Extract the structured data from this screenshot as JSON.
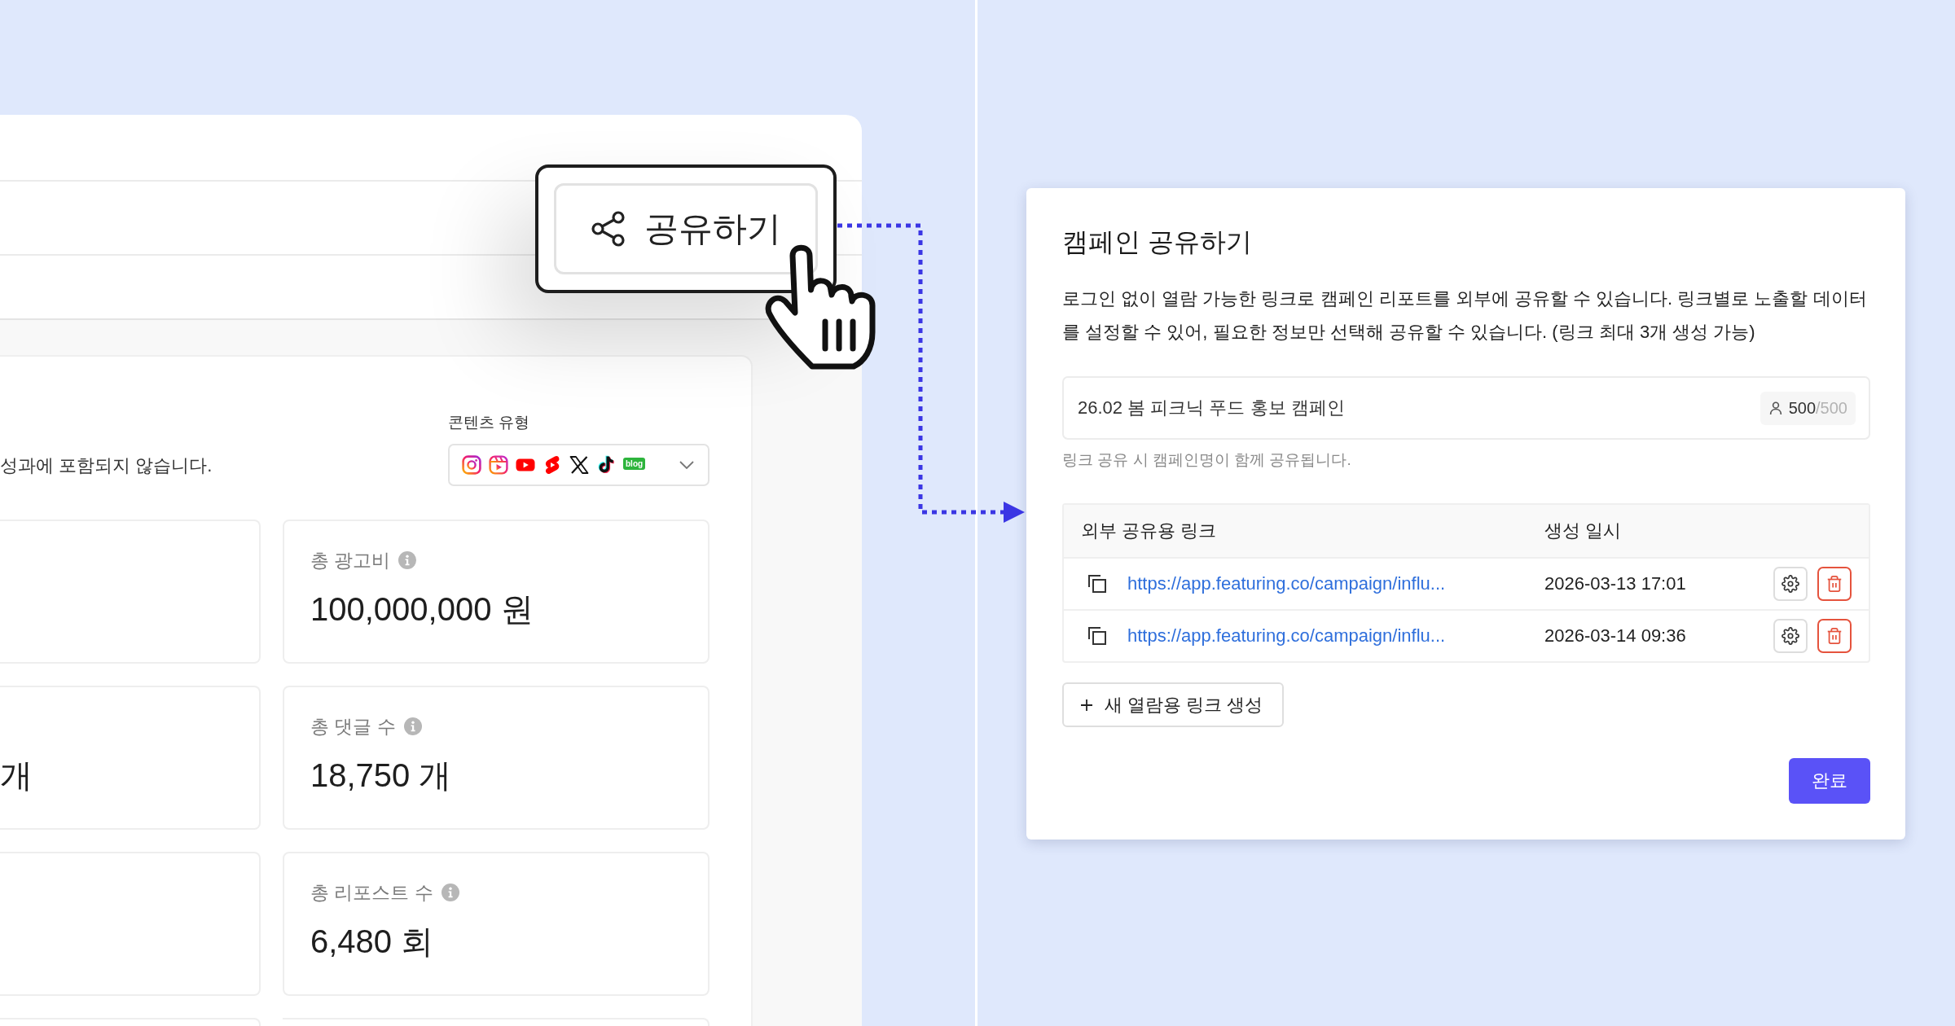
{
  "share_popup": {
    "button_label": "공유하기"
  },
  "report_panel": {
    "notice": "성과에 포함되지 않습니다.",
    "content_type": {
      "label": "콘텐츠 유형",
      "platforms": [
        {
          "kind": "instagram"
        },
        {
          "kind": "reels"
        },
        {
          "kind": "youtube"
        },
        {
          "kind": "shorts"
        },
        {
          "kind": "x"
        },
        {
          "kind": "tiktok"
        },
        {
          "kind": "blog",
          "text": "blog"
        }
      ]
    },
    "card_rows": [
      {
        "cards": [
          {
            "kind": "clipped"
          },
          {
            "kind": "metric",
            "label": "총 광고비",
            "value": "100,000,000 원"
          }
        ]
      },
      {
        "cards": [
          {
            "kind": "clipped",
            "value": "개"
          },
          {
            "kind": "metric",
            "label": "총 댓글 수",
            "value": "18,750 개"
          }
        ]
      },
      {
        "cards": [
          {
            "kind": "clipped"
          },
          {
            "kind": "metric",
            "label": "총 리포스트 수",
            "value": "6,480 회"
          }
        ]
      },
      {
        "cards": [
          {
            "kind": "clipped"
          },
          {
            "kind": "clipped"
          }
        ]
      }
    ]
  },
  "share_dialog": {
    "title": "캠페인 공유하기",
    "description": "로그인 없이 열람 가능한 링크로 캠페인 리포트를 외부에 공유할 수 있습니다. 링크별로 노출할 데이터를 설정할 수 있어, 필요한 정보만 선택해 공유할 수 있습니다. (링크 최대 3개 생성 가능)",
    "campaign_name": {
      "value": "26.02 봄 피크닉 푸드 홍보 캠페인",
      "count": "500",
      "limit": "/500"
    },
    "hint": "링크 공유 시 캠페인명이 함께 공유됩니다.",
    "links_table": {
      "columns": [
        "외부 공유용 링크",
        "생성 일시"
      ],
      "rows": [
        {
          "url": "https://app.featuring.co/campaign/influ...",
          "created_at": "2026-03-13 17:01"
        },
        {
          "url": "https://app.featuring.co/campaign/influ...",
          "created_at": "2026-03-14 09:36"
        }
      ]
    },
    "new_link_button": "새 열람용 링크 생성",
    "done_button": "완료"
  }
}
